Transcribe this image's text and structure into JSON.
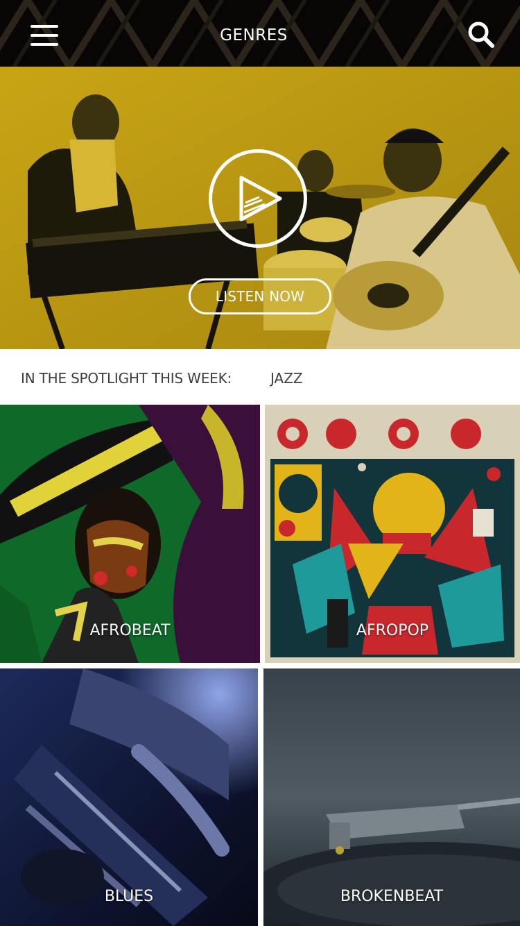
{
  "header": {
    "title": "GENRES"
  },
  "hero": {
    "listen_label": "LISTEN NOW"
  },
  "spotlight": {
    "label": "IN THE SPOTLIGHT THIS WEEK:",
    "genre": "JAZZ"
  },
  "genres": [
    {
      "label": "AFROBEAT"
    },
    {
      "label": "AFROPOP"
    },
    {
      "label": "BLUES"
    },
    {
      "label": "BROKENBEAT"
    }
  ],
  "colors": {
    "header_bg": "#070605",
    "hero_tint": "#b8960f",
    "text_dark": "#3d3d3d"
  },
  "icons": {
    "menu": "hamburger-menu-icon",
    "search": "search-icon",
    "play": "play-icon"
  }
}
